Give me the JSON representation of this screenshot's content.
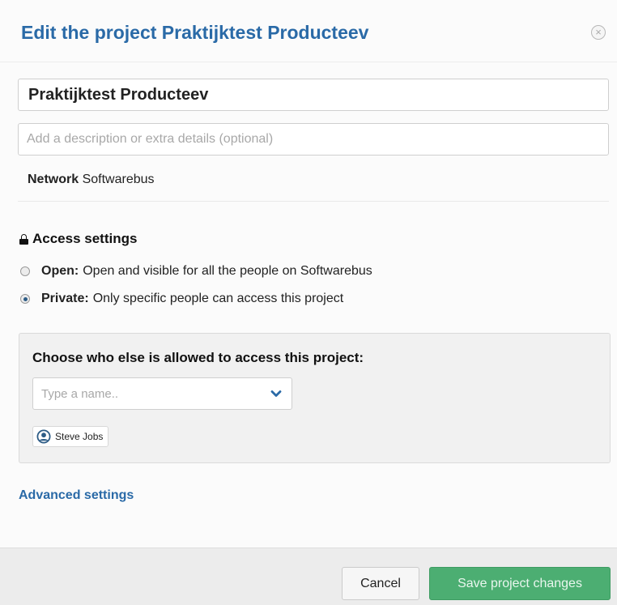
{
  "dialog": {
    "title": "Edit the project Praktijktest Producteev",
    "close_symbol": "×"
  },
  "form": {
    "project_name": "Praktijktest Producteev",
    "description_value": "",
    "description_placeholder": "Add a description or extra details (optional)",
    "network_label": "Network",
    "network_value": "Softwarebus"
  },
  "access": {
    "heading": "Access settings",
    "options": [
      {
        "label": "Open:",
        "description": "Open and visible for all the people on Softwarebus",
        "selected": false
      },
      {
        "label": "Private:",
        "description": "Only specific people can access this project",
        "selected": true
      }
    ],
    "share_heading": "Choose who else is allowed to access this project:",
    "name_placeholder": "Type a name..",
    "members": [
      {
        "name": "Steve Jobs"
      }
    ]
  },
  "advanced_label": "Advanced settings",
  "footer": {
    "cancel_label": "Cancel",
    "save_label": "Save project changes"
  },
  "colors": {
    "title": "#2a6aa7",
    "link": "#2a6aa7",
    "save_button": "#4cae72",
    "user_icon": "#2d5c86"
  },
  "icons": {
    "close": "close-icon",
    "lock": "lock-icon",
    "chevron": "chevron-down-icon",
    "user": "user-icon"
  }
}
